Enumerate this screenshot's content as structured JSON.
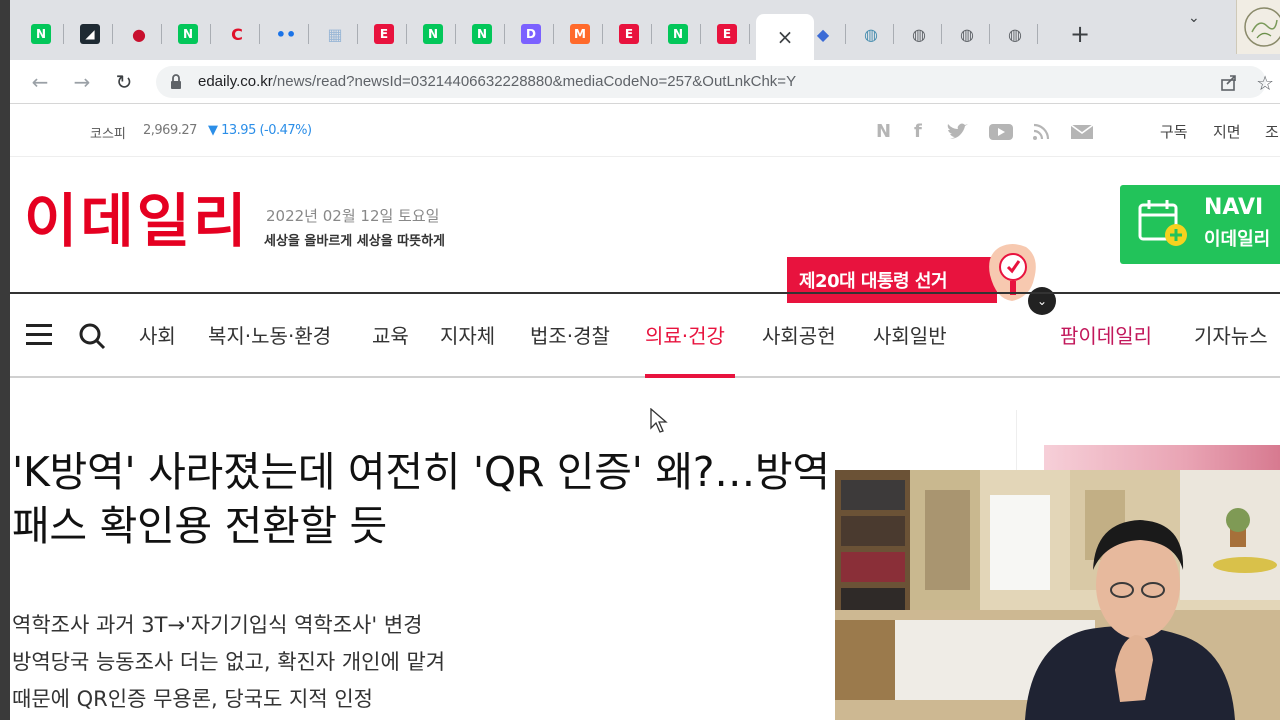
{
  "browser": {
    "tabs": [
      {
        "icon": "naver-n-icon",
        "glyph": "N",
        "color": "#03c75a"
      },
      {
        "icon": "dark-app-icon",
        "glyph": "◢",
        "color": "#1e2a33"
      },
      {
        "icon": "taegeuk-icon",
        "glyph": "●",
        "color": "#c8102e"
      },
      {
        "icon": "naver-n-icon",
        "glyph": "N",
        "color": "#03c75a"
      },
      {
        "icon": "red-swoosh-icon",
        "glyph": "C",
        "color": "#e0102a"
      },
      {
        "icon": "dots-icon",
        "glyph": "••",
        "color": "#1a73e8"
      },
      {
        "icon": "image-icon",
        "glyph": "▦",
        "color": "#9ab7d6"
      },
      {
        "icon": "edaily-e-icon",
        "glyph": "E",
        "color": "#e8133e"
      },
      {
        "icon": "naver-n-icon",
        "glyph": "N",
        "color": "#03c75a"
      },
      {
        "icon": "naver-n-icon",
        "glyph": "N",
        "color": "#03c75a"
      },
      {
        "icon": "daum-d-icon",
        "glyph": "D",
        "color": "#7b61ff"
      },
      {
        "icon": "m-icon",
        "glyph": "M",
        "color": "#ff6a2b"
      },
      {
        "icon": "edaily-e-icon",
        "glyph": "E",
        "color": "#e8133e"
      },
      {
        "icon": "naver-n-icon",
        "glyph": "N",
        "color": "#03c75a"
      },
      {
        "icon": "edaily-e-icon",
        "glyph": "E",
        "color": "#e8133e"
      }
    ],
    "active_tab_close": "×",
    "tabs_after": [
      {
        "icon": "shield-icon",
        "glyph": "◆",
        "color": "#3b6bd6"
      },
      {
        "icon": "globe-icon",
        "glyph": "◍",
        "color": "#4a8fb0"
      },
      {
        "icon": "globe-icon",
        "glyph": "◍",
        "color": "#5f6368"
      },
      {
        "icon": "globe-icon",
        "glyph": "◍",
        "color": "#5f6368"
      },
      {
        "icon": "globe-icon",
        "glyph": "◍",
        "color": "#5f6368"
      }
    ],
    "new_tab": "+",
    "tab_dropdown": "⌄",
    "url_host": "edaily.co.kr",
    "url_path": "/news/read?newsId=03214406632228880&mediaCodeNo=257&OutLnkChk=Y"
  },
  "topbar": {
    "kospi_label": "코스피",
    "kospi_value": "2,969.27",
    "kospi_change": "▼ 13.95 (-0.47%)",
    "links": [
      "구독",
      "지면",
      "조"
    ]
  },
  "brand": {
    "logo": "이데일리",
    "date": "2022년 02월 12일 토요일",
    "slogan": "세상을 올바르게 세상을 따뜻하게",
    "accent": "#e8133e"
  },
  "election_banner": "제20대 대통령 선거",
  "navi_ad": {
    "title": "NAVI",
    "subtitle": "이데일리"
  },
  "nav": {
    "items": [
      "사회",
      "복지·노동·환경",
      "교육",
      "지자체",
      "법조·경찰",
      "의료·건강",
      "사회공헌",
      "사회일반"
    ],
    "active": "의료·건강",
    "right": [
      "팜이데일리",
      "기자뉴스"
    ]
  },
  "article": {
    "headline_line1": "'K방역' 사라졌는데 여전히 'QR 인증' 왜?…방역",
    "headline_line2": "패스 확인용 전환할 듯",
    "summary": [
      "역학조사 과거 3T→'자기기입식 역학조사' 변경",
      "방역당국 능동조사 더는 없고, 확진자 개인에 맡겨",
      "때문에 QR인증 무용론, 당국도 지적 인정"
    ]
  }
}
